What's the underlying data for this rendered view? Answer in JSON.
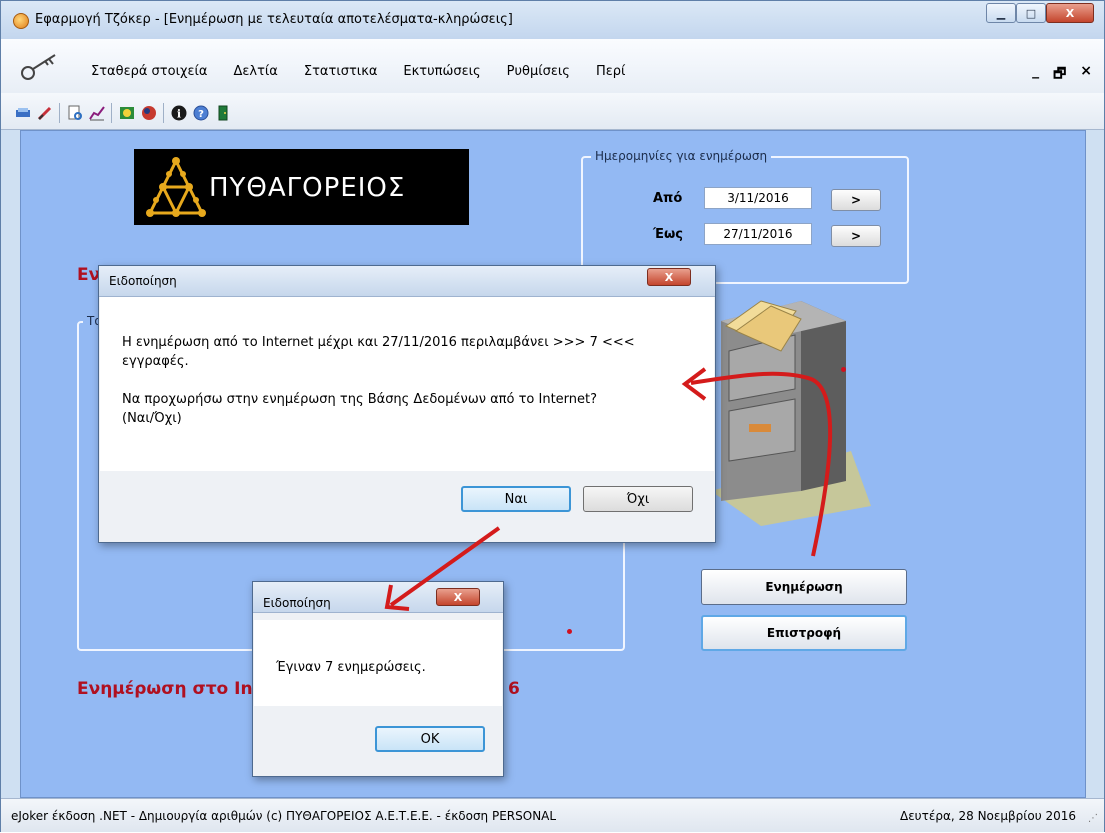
{
  "window": {
    "title": "Εφαρμογή Τζόκερ - [Ενημέρωση με τελευταία αποτελέσματα-κληρώσεις]",
    "controls": [
      "minimize-icon",
      "maximize-icon",
      "close-icon"
    ],
    "close_label": "X"
  },
  "menu": {
    "items": [
      "Σταθερά στοιχεία",
      "Δελτία",
      "Στατιστικα",
      "Εκτυπώσεις",
      "Ρυθμίσεις",
      "Περί"
    ],
    "mdi_controls": [
      "_",
      "🗗",
      "×"
    ]
  },
  "toolbar": {
    "icons": [
      "tickets-icon",
      "pencil-icon",
      "print-preview-icon",
      "chart-icon",
      "draw-icon",
      "magnifier-icon",
      "ball-icon",
      "info-icon",
      "help-icon",
      "exit-icon"
    ]
  },
  "logo": {
    "text": "ΠΥΘΑΓΟΡΕΙΟΣ"
  },
  "dates_group": {
    "legend": "Ημερομηνίες για ενημέρωση",
    "from_label": "Από",
    "from_value": "3/11/2016",
    "to_label": "Έως",
    "to_value": "27/11/2016",
    "arrow_label": ">"
  },
  "background": {
    "heading_top_fragment": "Εν",
    "inner_group_fragment": "Τα",
    "heading_bottom_left": "Ενημέρωση στο In",
    "heading_bottom_right": "6"
  },
  "buttons": {
    "update": "Ενημέρωση",
    "back": "Επιστροφή"
  },
  "dialog_confirm": {
    "title": "Ειδοποίηση",
    "close_label": "X",
    "line1": "Η ενημέρωση από το Internet μέχρι και 27/11/2016 περιλαμβάνει >>> 7 <<<",
    "line2": "εγγραφές.",
    "line3": "Να προχωρήσω στην ενημέρωση της Βάσης Δεδομένων από το Internet?",
    "line4": "(Ναι/Όχι)",
    "yes": "Ναι",
    "no": "Όχι"
  },
  "dialog_result": {
    "title": "Ειδοποίηση",
    "close_label": "X",
    "message": "Έγιναν  7  ενημερώσεις.",
    "ok": "OK"
  },
  "status": {
    "left": "eJoker έκδοση .NET  - Δημιουργία αριθμών  (c) ΠΥΘΑΓΟΡΕΙΟΣ  Α.Ε.Τ.Ε.Ε.  - έκδοση PERSONAL",
    "right": "Δευτέρα, 28 Νοεμβρίου 2016"
  },
  "colors": {
    "client_bg": "#93b9f3",
    "heading_red": "#b01020",
    "arrow_red": "#d41b1b"
  }
}
